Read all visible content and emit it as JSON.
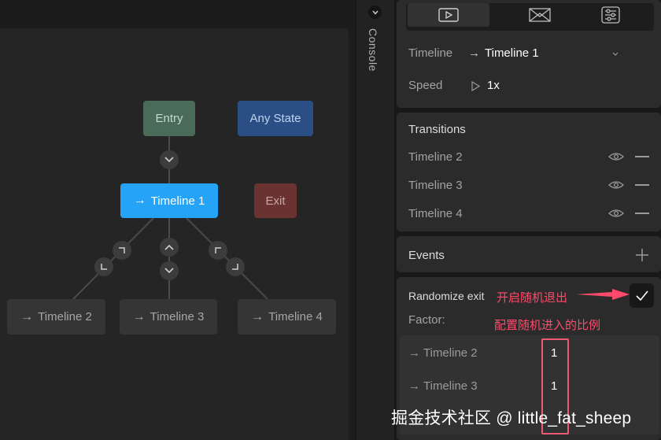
{
  "graph": {
    "nodes": {
      "entry": "Entry",
      "any_state": "Any State",
      "timeline1": "Timeline 1",
      "exit": "Exit",
      "timeline2": "Timeline 2",
      "timeline3": "Timeline 3",
      "timeline4": "Timeline 4"
    },
    "arrow_glyph": "→"
  },
  "console": {
    "label": "Console"
  },
  "tabs": [
    {
      "name": "timeline-tab",
      "icon": "play-icon"
    },
    {
      "name": "blend-tab",
      "icon": "blend-icon"
    },
    {
      "name": "settings-tab",
      "icon": "sliders-icon"
    }
  ],
  "properties": {
    "timeline_label": "Timeline",
    "timeline_value": "Timeline 1",
    "speed_label": "Speed",
    "speed_value": "1x"
  },
  "transitions": {
    "title": "Transitions",
    "items": [
      "Timeline 2",
      "Timeline 3",
      "Timeline 4"
    ]
  },
  "events": {
    "title": "Events"
  },
  "randomize": {
    "title": "Randomize exit",
    "factor_label": "Factor:",
    "checked": true,
    "factors": [
      {
        "label": "Timeline 2",
        "value": "1"
      },
      {
        "label": "Timeline 3",
        "value": "1"
      }
    ]
  },
  "annotations": {
    "enable_random_exit": "开启随机退出",
    "configure_ratio": "配置随机进入的比例",
    "color": "#ff4a6b"
  },
  "watermark": "掘金技术社区 @ little_fat_sheep",
  "colors": {
    "selected_node": "#24a3f7",
    "entry_node": "#4a6b58",
    "any_state_node": "#2b4e86",
    "exit_node": "#6b3232"
  }
}
